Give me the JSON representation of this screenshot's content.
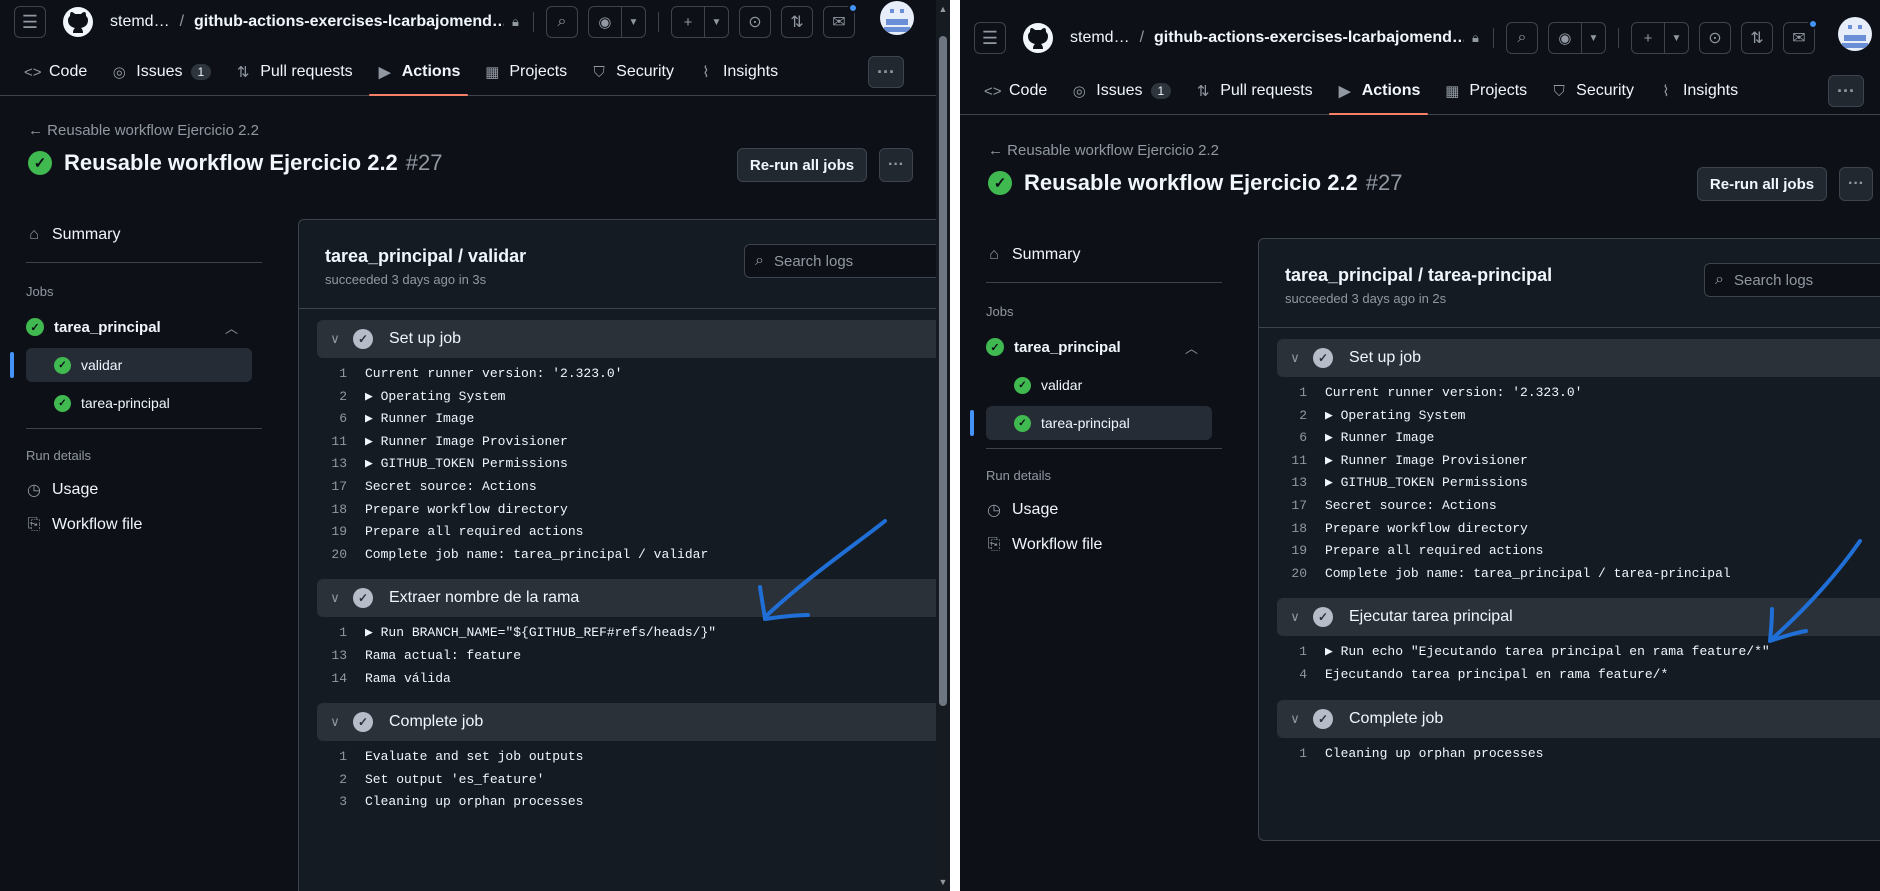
{
  "header": {
    "owner": "stemd…",
    "sep": "/",
    "repo": "github-actions-exercises-lcarbajomend…"
  },
  "tabs": [
    {
      "icon": "code-icon",
      "glyph": "<>",
      "label": "Code"
    },
    {
      "icon": "issues-icon",
      "glyph": "◎",
      "label": "Issues",
      "count": "1"
    },
    {
      "icon": "pull-request-icon",
      "glyph": "⇅",
      "label": "Pull requests"
    },
    {
      "icon": "actions-icon",
      "glyph": "▶",
      "label": "Actions"
    },
    {
      "icon": "projects-icon",
      "glyph": "▦",
      "label": "Projects"
    },
    {
      "icon": "security-icon",
      "glyph": "⛉",
      "label": "Security"
    },
    {
      "icon": "insights-icon",
      "glyph": "⌇",
      "label": "Insights"
    }
  ],
  "run": {
    "back_label": "Reusable workflow Ejercicio 2.2",
    "title": "Reusable workflow Ejercicio 2.2",
    "number": "#27",
    "rerun_label": "Re-run all jobs"
  },
  "sidebar": {
    "summary": "Summary",
    "jobs_heading": "Jobs",
    "parent_job": "tarea_principal",
    "jobs": [
      "validar",
      "tarea-principal"
    ],
    "run_details_heading": "Run details",
    "usage": "Usage",
    "workflow_file": "Workflow file"
  },
  "search_placeholder": "Search logs",
  "left": {
    "job_title": "tarea_principal / validar",
    "job_meta": "succeeded 3 days ago in 3s",
    "steps": [
      {
        "name": "Set up job",
        "lines": [
          {
            "n": "1",
            "t": "Current runner version: '2.323.0'"
          },
          {
            "n": "2",
            "t": "▶ Operating System"
          },
          {
            "n": "6",
            "t": "▶ Runner Image"
          },
          {
            "n": "11",
            "t": "▶ Runner Image Provisioner"
          },
          {
            "n": "13",
            "t": "▶ GITHUB_TOKEN Permissions"
          },
          {
            "n": "17",
            "t": "Secret source: Actions"
          },
          {
            "n": "18",
            "t": "Prepare workflow directory"
          },
          {
            "n": "19",
            "t": "Prepare all required actions"
          },
          {
            "n": "20",
            "t": "Complete job name: tarea_principal / validar"
          }
        ]
      },
      {
        "name": "Extraer nombre de la rama",
        "lines": [
          {
            "n": "1",
            "t": "▶ Run BRANCH_NAME=\"${GITHUB_REF#refs/heads/}\""
          },
          {
            "n": "13",
            "t": "Rama actual: feature"
          },
          {
            "n": "14",
            "t": "Rama válida"
          }
        ]
      },
      {
        "name": "Complete job",
        "lines": [
          {
            "n": "1",
            "t": "Evaluate and set job outputs"
          },
          {
            "n": "2",
            "t": "Set output 'es_feature'"
          },
          {
            "n": "3",
            "t": "Cleaning up orphan processes"
          }
        ]
      }
    ]
  },
  "right": {
    "job_title": "tarea_principal / tarea-principal",
    "job_meta": "succeeded 3 days ago in 2s",
    "steps": [
      {
        "name": "Set up job",
        "lines": [
          {
            "n": "1",
            "t": "Current runner version: '2.323.0'"
          },
          {
            "n": "2",
            "t": "▶ Operating System"
          },
          {
            "n": "6",
            "t": "▶ Runner Image"
          },
          {
            "n": "11",
            "t": "▶ Runner Image Provisioner"
          },
          {
            "n": "13",
            "t": "▶ GITHUB_TOKEN Permissions"
          },
          {
            "n": "17",
            "t": "Secret source: Actions"
          },
          {
            "n": "18",
            "t": "Prepare workflow directory"
          },
          {
            "n": "19",
            "t": "Prepare all required actions"
          },
          {
            "n": "20",
            "t": "Complete job name: tarea_principal / tarea-principal"
          }
        ]
      },
      {
        "name": "Ejecutar tarea principal",
        "lines": [
          {
            "n": "1",
            "t": "▶ Run echo \"Ejecutando tarea principal en rama feature/*\""
          },
          {
            "n": "4",
            "t": "Ejecutando tarea principal en rama feature/*"
          }
        ]
      },
      {
        "name": "Complete job",
        "lines": [
          {
            "n": "1",
            "t": "Cleaning up orphan processes"
          }
        ]
      }
    ]
  },
  "colors": {
    "success": "#3fb950",
    "accent": "#f78166",
    "annotation": "#1f6fd6"
  }
}
